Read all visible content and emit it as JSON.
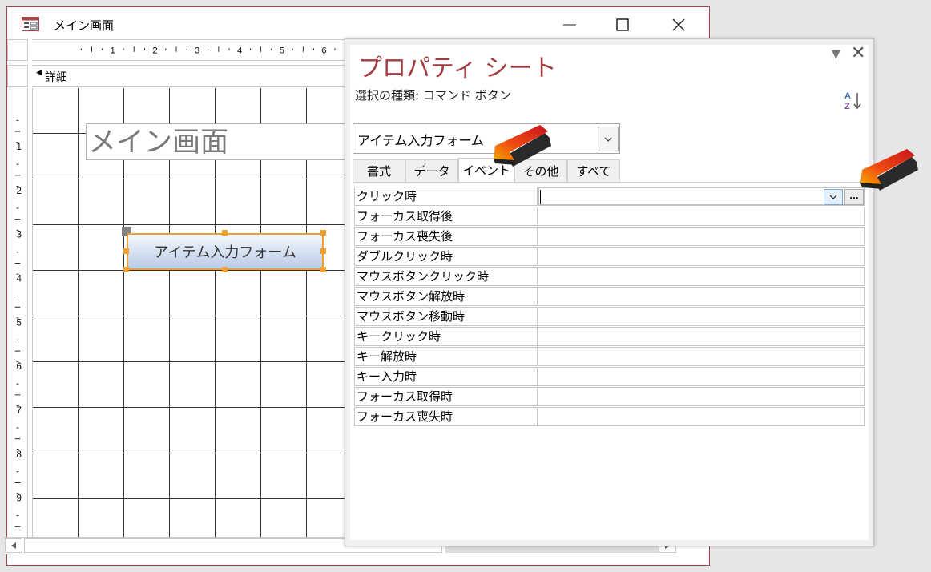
{
  "form_window": {
    "title": "メイン画面",
    "section_label": "詳細",
    "title_label_text": "メイン画面",
    "command_button_text": "アイテム入力フォーム",
    "h_ruler_marks": [
      "1",
      "2",
      "3",
      "4",
      "5",
      "6"
    ],
    "v_ruler_marks": [
      "1",
      "2",
      "3",
      "4",
      "5",
      "6",
      "7",
      "8",
      "9"
    ]
  },
  "property_sheet": {
    "title": "プロパティ シート",
    "selection_type": "選択の種類:  コマンド ボタン",
    "object_selector_value": "アイテム入力フォーム",
    "tabs": [
      {
        "label": "書式",
        "active": false
      },
      {
        "label": "データ",
        "active": false
      },
      {
        "label": "イベント",
        "active": true
      },
      {
        "label": "その他",
        "active": false
      },
      {
        "label": "すべて",
        "active": false
      }
    ],
    "properties": [
      {
        "name": "クリック時",
        "value": ""
      },
      {
        "name": "フォーカス取得後",
        "value": ""
      },
      {
        "name": "フォーカス喪失後",
        "value": ""
      },
      {
        "name": "ダブルクリック時",
        "value": ""
      },
      {
        "name": "マウスボタンクリック時",
        "value": ""
      },
      {
        "name": "マウスボタン解放時",
        "value": ""
      },
      {
        "name": "マウスボタン移動時",
        "value": ""
      },
      {
        "name": "キークリック時",
        "value": ""
      },
      {
        "name": "キー解放時",
        "value": ""
      },
      {
        "name": "キー入力時",
        "value": ""
      },
      {
        "name": "フォーカス取得時",
        "value": ""
      },
      {
        "name": "フォーカス喪失時",
        "value": ""
      }
    ],
    "builder_button_text": "..."
  },
  "colors": {
    "window_border": "#a94548",
    "property_title": "#a23a3e",
    "selection_handle": "#f0a030",
    "annotation_arrow": "#e8261a"
  }
}
